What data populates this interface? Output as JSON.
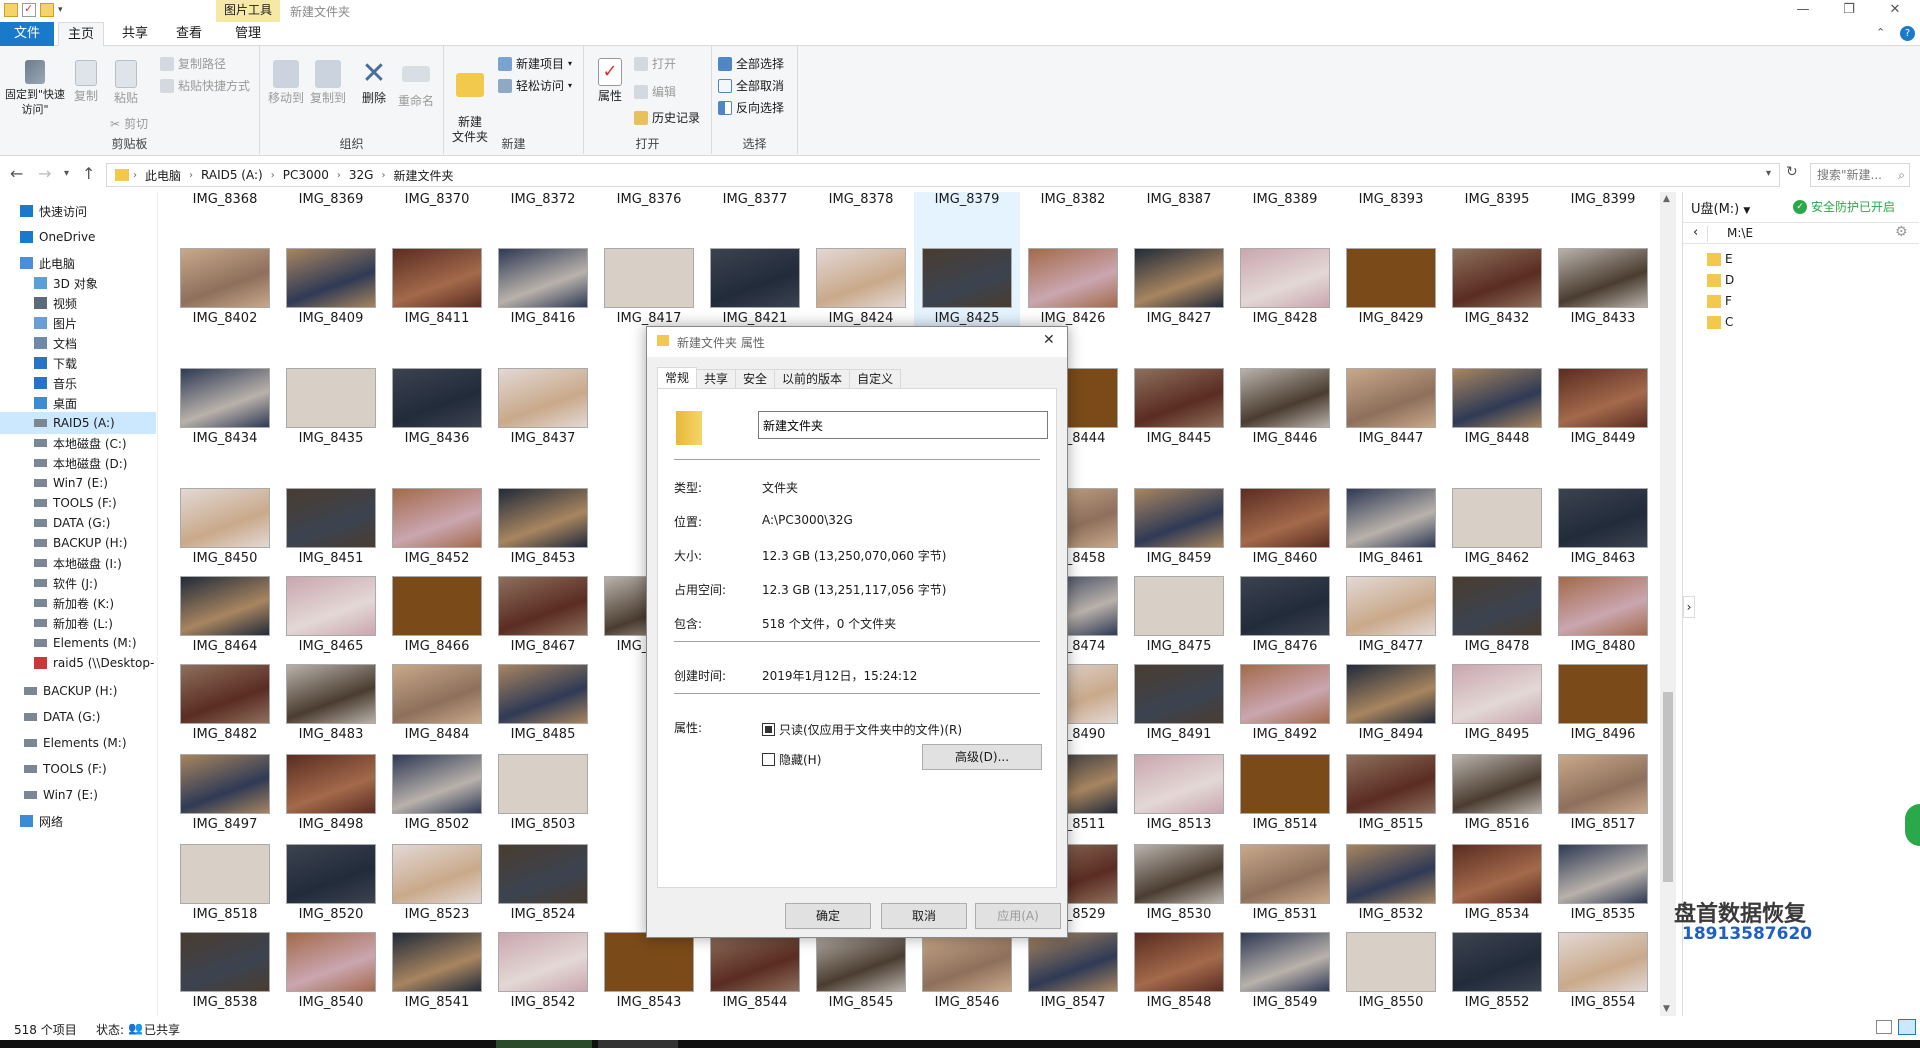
{
  "window": {
    "context_tab": "图片工具",
    "title": "新建文件夹"
  },
  "ribbon": {
    "tabs": [
      "文件",
      "主页",
      "共享",
      "查看",
      "管理"
    ],
    "groups": {
      "clipboard": {
        "label": "剪贴板",
        "pin": "固定到\"快速访问\"",
        "copy": "复制",
        "paste": "粘贴",
        "copy_path": "复制路径",
        "paste_shortcut": "粘贴快捷方式",
        "cut": "剪切"
      },
      "organize": {
        "label": "组织",
        "move_to": "移动到",
        "copy_to": "复制到",
        "delete": "删除",
        "rename": "重命名"
      },
      "new": {
        "label": "新建",
        "new_folder": "新建\n文件夹",
        "new_item": "新建项目",
        "easy_access": "轻松访问"
      },
      "open": {
        "label": "打开",
        "properties": "属性",
        "open": "打开",
        "edit": "编辑",
        "history": "历史记录"
      },
      "select": {
        "label": "选择",
        "select_all": "全部选择",
        "select_none": "全部取消",
        "invert": "反向选择"
      }
    }
  },
  "address": {
    "crumbs": [
      "此电脑",
      "RAID5 (A:)",
      "PC3000",
      "32G",
      "新建文件夹"
    ],
    "search_placeholder": "搜索\"新建..."
  },
  "nav": {
    "items": [
      {
        "label": "快速访问",
        "icon": "star-icon"
      },
      {
        "label": "OneDrive",
        "icon": "cloud-icon"
      },
      {
        "label": "此电脑",
        "icon": "computer-icon"
      },
      {
        "label": "3D 对象",
        "icon": "cube-icon"
      },
      {
        "label": "视频",
        "icon": "video-icon"
      },
      {
        "label": "图片",
        "icon": "picture-icon"
      },
      {
        "label": "文档",
        "icon": "document-icon"
      },
      {
        "label": "下载",
        "icon": "download-icon"
      },
      {
        "label": "音乐",
        "icon": "music-icon"
      },
      {
        "label": "桌面",
        "icon": "desktop-icon"
      },
      {
        "label": "RAID5 (A:)",
        "icon": "drive-icon"
      },
      {
        "label": "本地磁盘 (C:)",
        "icon": "drive-icon"
      },
      {
        "label": "本地磁盘 (D:)",
        "icon": "drive-icon"
      },
      {
        "label": "Win7 (E:)",
        "icon": "drive-icon"
      },
      {
        "label": "TOOLS (F:)",
        "icon": "drive-icon"
      },
      {
        "label": "DATA (G:)",
        "icon": "drive-icon"
      },
      {
        "label": "BACKUP (H:)",
        "icon": "drive-icon"
      },
      {
        "label": "本地磁盘 (I:)",
        "icon": "drive-icon"
      },
      {
        "label": "软件 (J:)",
        "icon": "drive-icon"
      },
      {
        "label": "新加卷 (K:)",
        "icon": "drive-icon"
      },
      {
        "label": "新加卷 (L:)",
        "icon": "drive-icon"
      },
      {
        "label": "Elements (M:)",
        "icon": "drive-icon"
      },
      {
        "label": "raid5 (\\\\Desktop-",
        "icon": "network-drive-icon"
      },
      {
        "label": "BACKUP (H:)",
        "icon": "drive-icon"
      },
      {
        "label": "DATA (G:)",
        "icon": "drive-icon"
      },
      {
        "label": "Elements (M:)",
        "icon": "drive-icon"
      },
      {
        "label": "TOOLS (F:)",
        "icon": "drive-icon"
      },
      {
        "label": "Win7 (E:)",
        "icon": "drive-icon"
      },
      {
        "label": "网络",
        "icon": "network-icon"
      }
    ]
  },
  "files": {
    "rows": [
      [
        "IMG_8368",
        "IMG_8369",
        "IMG_8370",
        "IMG_8372",
        "IMG_8376",
        "IMG_8377",
        "IMG_8378",
        "IMG_8379",
        "IMG_8382",
        "IMG_8387",
        "IMG_8389",
        "IMG_8393",
        "IMG_8395",
        "IMG_8399"
      ],
      [
        "IMG_8402",
        "IMG_8409",
        "IMG_8411",
        "IMG_8416",
        "IMG_8417",
        "IMG_8421",
        "IMG_8424",
        "IMG_8425",
        "IMG_8426",
        "IMG_8427",
        "IMG_8428",
        "IMG_8429",
        "IMG_8432",
        "IMG_8433"
      ],
      [
        "IMG_8434",
        "IMG_8435",
        "IMG_8436",
        "IMG_8437",
        "",
        "",
        "",
        "",
        "IMG_8444",
        "IMG_8445",
        "IMG_8446",
        "IMG_8447",
        "IMG_8448",
        "IMG_8449"
      ],
      [
        "IMG_8450",
        "IMG_8451",
        "IMG_8452",
        "IMG_8453",
        "",
        "",
        "",
        "",
        "IMG_8458",
        "IMG_8459",
        "IMG_8460",
        "IMG_8461",
        "IMG_8462",
        "IMG_8463"
      ],
      [
        "IMG_8464",
        "IMG_8465",
        "IMG_8466",
        "IMG_8467",
        "IMG_8471",
        "",
        "",
        "",
        "IMG_8474",
        "IMG_8475",
        "IMG_8476",
        "IMG_8477",
        "IMG_8478",
        "IMG_8480"
      ],
      [
        "IMG_8482",
        "IMG_8483",
        "IMG_8484",
        "IMG_8485",
        "",
        "",
        "",
        "",
        "IMG_8490",
        "IMG_8491",
        "IMG_8492",
        "IMG_8494",
        "IMG_8495",
        "IMG_8496"
      ],
      [
        "IMG_8497",
        "IMG_8498",
        "IMG_8502",
        "IMG_8503",
        "",
        "",
        "",
        "",
        "IMG_8511",
        "IMG_8513",
        "IMG_8514",
        "IMG_8515",
        "IMG_8516",
        "IMG_8517"
      ],
      [
        "IMG_8518",
        "IMG_8520",
        "IMG_8523",
        "IMG_8524",
        "",
        "",
        "",
        "",
        "IMG_8529",
        "IMG_8530",
        "IMG_8531",
        "IMG_8532",
        "IMG_8534",
        "IMG_8535"
      ],
      [
        "IMG_8538",
        "IMG_8540",
        "IMG_8541",
        "IMG_8542",
        "IMG_8543",
        "IMG_8544",
        "IMG_8545",
        "IMG_8546",
        "IMG_8547",
        "IMG_8548",
        "IMG_8549",
        "IMG_8550",
        "IMG_8552",
        "IMG_8554"
      ]
    ],
    "thumb_colors": [
      "#7a4a18",
      "#8d6f5c",
      "#b9b2ab",
      "#c9a98a",
      "#a88560",
      "#5a2c22",
      "#2f3a55",
      "#d8cfc6",
      "#3b4350",
      "#e3d8d5",
      "#4a3c30",
      "#a36a4b",
      "#222b3a",
      "#caa6b0"
    ]
  },
  "right_panel": {
    "drive": "U盘(M:)",
    "security_status": "安全防护已开启",
    "path": "M:\\E",
    "folders": [
      "E",
      "D",
      "F",
      "C"
    ]
  },
  "status": {
    "count": "518 个项目",
    "state_label": "状态:",
    "state_value": "已共享"
  },
  "dialog": {
    "title": "新建文件夹 属性",
    "tabs": [
      "常规",
      "共享",
      "安全",
      "以前的版本",
      "自定义"
    ],
    "name_value": "新建文件夹",
    "rows": {
      "type_label": "类型:",
      "type_value": "文件夹",
      "location_label": "位置:",
      "location_value": "A:\\PC3000\\32G",
      "size_label": "大小:",
      "size_value": "12.3 GB (13,250,070,060 字节)",
      "disk_label": "占用空间:",
      "disk_value": "12.3 GB (13,251,117,056 字节)",
      "contains_label": "包含:",
      "contains_value": "518 个文件，0 个文件夹",
      "created_label": "创建时间:",
      "created_value": "2019年1月12日，15:24:12",
      "attrs_label": "属性:",
      "readonly_label": "只读(仅应用于文件夹中的文件)(R)",
      "hidden_label": "隐藏(H)",
      "advanced_label": "高级(D)..."
    },
    "buttons": {
      "ok": "确定",
      "cancel": "取消",
      "apply": "应用(A)"
    }
  },
  "watermark": {
    "name": "盘首数据恢复",
    "phone": "18913587620"
  }
}
